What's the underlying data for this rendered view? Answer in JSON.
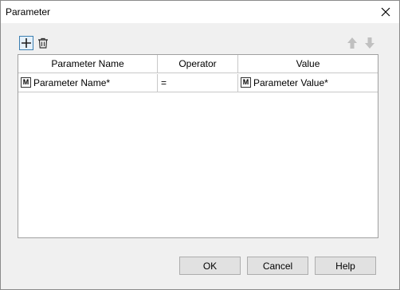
{
  "window": {
    "title": "Parameter",
    "close_glyph": "×"
  },
  "toolbar": {
    "add_icon": "add-icon",
    "delete_icon": "trash-icon",
    "move_up_icon": "arrow-up-icon",
    "move_down_icon": "arrow-down-icon"
  },
  "table": {
    "columns": [
      "Parameter Name",
      "Operator",
      "Value"
    ],
    "rows": [
      {
        "name_badge": "M",
        "name": "Parameter Name*",
        "operator": "=",
        "value_badge": "M",
        "value": "Parameter Value*"
      }
    ]
  },
  "buttons": {
    "ok": "OK",
    "cancel": "Cancel",
    "help": "Help"
  },
  "colors": {
    "accent": "#3c7fb1",
    "disabled_arrow": "#c0c0c0"
  }
}
